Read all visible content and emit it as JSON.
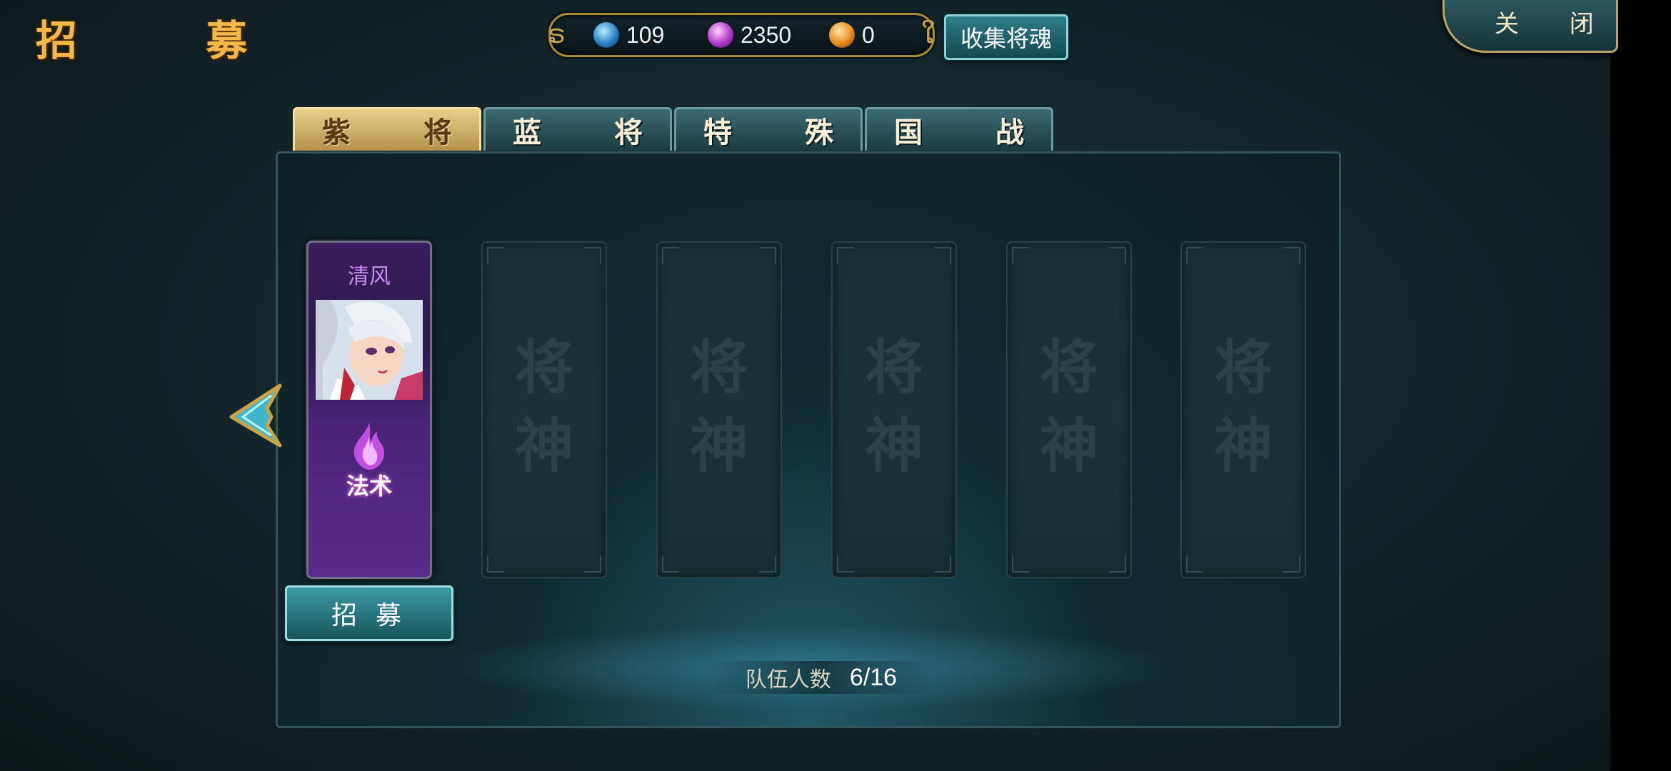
{
  "header": {
    "title": "招 募",
    "collect_button": "收集将魂",
    "close_button": "关 闭"
  },
  "resources": [
    {
      "icon": "blue-orb-icon",
      "value": "109",
      "color": "#2a7fc4"
    },
    {
      "icon": "purple-orb-icon",
      "value": "2350",
      "color": "#b13bc9"
    },
    {
      "icon": "gold-orb-icon",
      "value": "0",
      "color": "#e68a1e"
    }
  ],
  "tabs": [
    {
      "label": "紫 将",
      "active": true
    },
    {
      "label": "蓝 将",
      "active": false
    },
    {
      "label": "特 殊",
      "active": false
    },
    {
      "label": "国 战",
      "active": false
    }
  ],
  "general_card": {
    "name": "清风",
    "type": "法术",
    "type_icon": "flame-icon"
  },
  "recruit_button": "招 募",
  "empty_slot_mark": "将神",
  "team": {
    "label": "队伍人数",
    "value": "6/16"
  },
  "colors": {
    "accent_gold": "#f2b84b",
    "panel": "#122c33",
    "card_purple": "#4a2378"
  }
}
